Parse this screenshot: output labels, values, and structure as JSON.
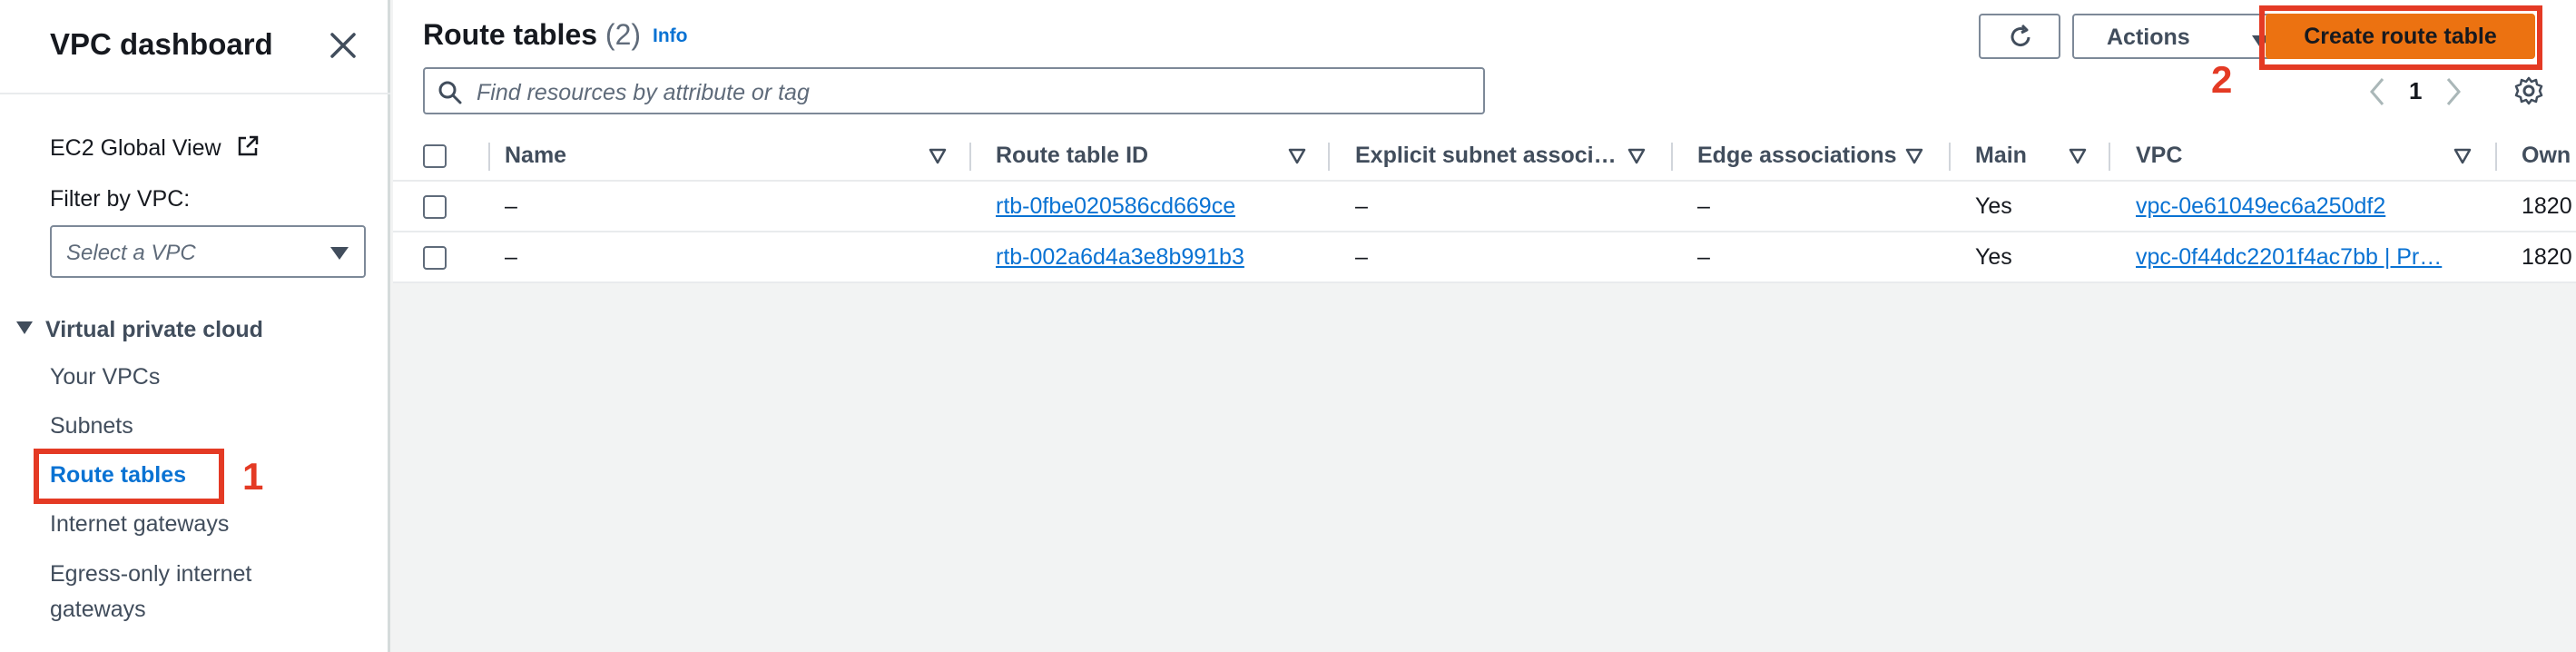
{
  "sidebar": {
    "title": "VPC dashboard",
    "global_view": "EC2 Global View",
    "filter_label": "Filter by VPC:",
    "filter_placeholder": "Select a VPC",
    "section_title": "Virtual private cloud",
    "items": [
      {
        "label": "Your VPCs"
      },
      {
        "label": "Subnets"
      },
      {
        "label": "Route tables"
      },
      {
        "label": "Internet gateways"
      },
      {
        "label": "Egress-only internet"
      },
      {
        "label": "gateways"
      }
    ],
    "annotation": "1"
  },
  "header": {
    "title": "Route tables",
    "count": "(2)",
    "info": "Info",
    "actions_label": "Actions",
    "create_label": "Create route table",
    "annotation": "2",
    "search_placeholder": "Find resources by attribute or tag",
    "page_number": "1"
  },
  "table": {
    "columns": [
      "Name",
      "Route table ID",
      "Explicit subnet associ…",
      "Edge associations",
      "Main",
      "VPC",
      "Own"
    ],
    "rows": [
      {
        "name": "–",
        "route_table_id": "rtb-0fbe020586cd669ce",
        "explicit": "–",
        "edge": "–",
        "main": "Yes",
        "vpc": "vpc-0e61049ec6a250df2",
        "owner": "1820"
      },
      {
        "name": "–",
        "route_table_id": "rtb-002a6d4a3e8b991b3",
        "explicit": "–",
        "edge": "–",
        "main": "Yes",
        "vpc": "vpc-0f44dc2201f4ac7bb | Pr…",
        "owner": "1820"
      }
    ]
  },
  "colors": {
    "primary_button": "#ec7211",
    "link": "#0972d3",
    "annotation": "#e43a24"
  },
  "icons": [
    "close-icon",
    "external-link-icon",
    "chevron-down-icon",
    "caret-down-icon",
    "refresh-icon",
    "search-icon",
    "chevron-left-icon",
    "chevron-right-icon",
    "gear-icon",
    "sort-icon"
  ]
}
